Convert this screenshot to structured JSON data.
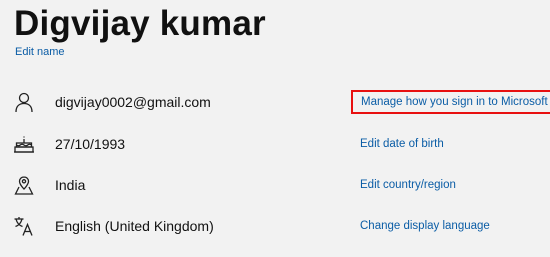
{
  "profile": {
    "name": "Digvijay kumar",
    "edit_name_label": "Edit name"
  },
  "rows": [
    {
      "icon": "person-icon",
      "value": "digvijay0002@gmail.com",
      "link": "Manage how you sign in to Microsoft"
    },
    {
      "icon": "cake-icon",
      "value": "27/10/1993",
      "link": "Edit date of birth"
    },
    {
      "icon": "location-icon",
      "value": "India",
      "link": "Edit country/region"
    },
    {
      "icon": "language-icon",
      "value": "English (United Kingdom)",
      "link": "Change display language"
    }
  ],
  "colors": {
    "background": "#f2f2f2",
    "link": "#0b5da6",
    "highlight_border": "#e81010"
  }
}
